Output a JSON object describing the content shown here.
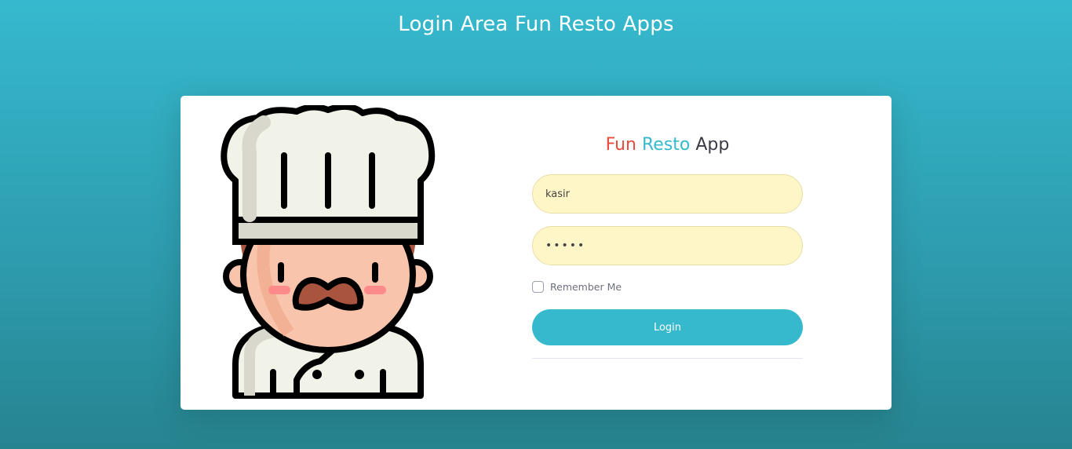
{
  "page": {
    "title": "Login Area Fun Resto Apps"
  },
  "card": {
    "brand": {
      "word1": "Fun",
      "word2": "Resto",
      "word3": "App"
    },
    "username": {
      "value": "kasir"
    },
    "password": {
      "value": "•••••"
    },
    "remember_label": "Remember Me",
    "remember_checked": false,
    "login_label": "Login",
    "illustration_icon": "chef-icon"
  },
  "colors": {
    "background_top": "#36b9ce",
    "background_bottom": "#26848f",
    "brand_fun": "#e74c3c",
    "brand_resto": "#36b9cc",
    "brand_app": "#3a3b45",
    "input_bg": "#fff6c8",
    "button_bg": "#36b9cc"
  }
}
